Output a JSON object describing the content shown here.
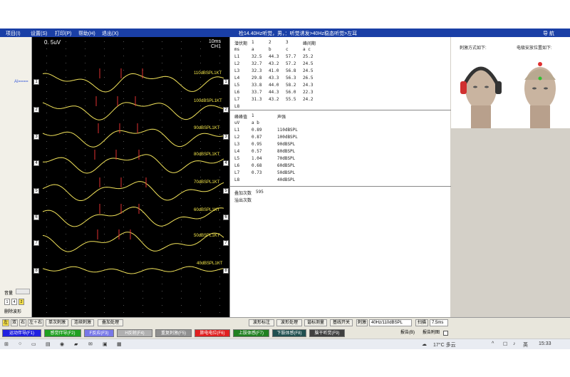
{
  "window": {
    "title": "检14.40Hz听觉，男，：听觉诱发>40Hz稳态听觉>左耳",
    "brand": "导 航"
  },
  "menu": [
    "项目(I)",
    "设置(S)",
    "打印(P)",
    "帮助(H)",
    "退出(X)"
  ],
  "left": {
    "ai_label": "AI",
    "volume_label": "音量",
    "mini_buttons": [
      "1",
      "4",
      "2"
    ],
    "clear_wave": "删除波形"
  },
  "scope": {
    "scale": "0. 5uV",
    "time": "10ms",
    "channel": "CH1",
    "channels": [
      "1",
      "2",
      "3",
      "4",
      "5",
      "6",
      "7",
      "8"
    ],
    "db_labels": [
      "110dBSPL1KT",
      "100dBSPL1KT",
      "90dBSPL1KT",
      "80dBSPL1KT",
      "70dBSPL1KT",
      "60dBSPL1KT",
      "50dBSPL1KT",
      "40dBSPL1KT"
    ],
    "wave_color": "#f2e35a",
    "marker_color": "#e03030"
  },
  "latency": {
    "title_cols": [
      "潜伏期",
      "1",
      "2",
      "3",
      "峰间期"
    ],
    "unit_row": [
      "ms",
      "a",
      "b",
      "c",
      "a c"
    ],
    "rows": [
      [
        "L1",
        "32.5",
        "44.3",
        "57.7",
        "25.2"
      ],
      [
        "L2",
        "32.7",
        "43.2",
        "57.2",
        "24.5"
      ],
      [
        "L3",
        "32.3",
        "41.0",
        "56.8",
        "24.5"
      ],
      [
        "L4",
        "29.8",
        "43.3",
        "56.3",
        "26.5"
      ],
      [
        "L5",
        "33.8",
        "44.0",
        "58.2",
        "24.3"
      ],
      [
        "L6",
        "33.7",
        "44.3",
        "56.0",
        "22.3"
      ],
      [
        "L7",
        "31.3",
        "43.2",
        "55.5",
        "24.2"
      ],
      [
        "L8",
        "",
        "",
        "",
        ""
      ]
    ]
  },
  "amplitude": {
    "title_cols": [
      "峰峰值",
      "1",
      "声强"
    ],
    "unit_row": [
      "uV",
      "a b"
    ],
    "rows": [
      [
        "L1",
        "0.89",
        "110dBSPL"
      ],
      [
        "L2",
        "0.87",
        "100dBSPL"
      ],
      [
        "L3",
        "0.95",
        "90dBSPL"
      ],
      [
        "L4",
        "0.57",
        "80dBSPL"
      ],
      [
        "L5",
        "1.04",
        "70dBSPL"
      ],
      [
        "L6",
        "0.68",
        "60dBSPL"
      ],
      [
        "L7",
        "0.73",
        "50dBSPL"
      ],
      [
        "L8",
        "",
        "40dBSPL"
      ]
    ]
  },
  "counts": {
    "stack_label": "叠加次数",
    "stack_value": "595",
    "overflow_label": "溢出次数"
  },
  "images": {
    "left_caption": "刺激方式如下:",
    "right_caption": "电极安放位置如下:"
  },
  "controls": {
    "left_buttons": [
      "左",
      "双",
      "右",
      "左＋右",
      "单次刺激",
      "连续刺激",
      "叠加处理"
    ],
    "right_buttons": [
      "波形标注",
      "波形处理",
      "谐标测量",
      "基线开关"
    ],
    "stim_label": "刺激",
    "stim_value": "40Hz/110dBSPL",
    "scan_label": "扫描",
    "scan_value": "7.5ms"
  },
  "fkeys": [
    {
      "label": "运动伴导(F1)",
      "color": "#2020e0"
    },
    {
      "label": "感觉伴导(F2)",
      "color": "#20a020"
    },
    {
      "label": "F反应(F3)",
      "color": "#7878e8"
    },
    {
      "label": "H反射(F4)",
      "color": "#b0b0b0"
    },
    {
      "label": "重复刺激(F5)",
      "color": "#909090"
    },
    {
      "label": "肺电电位(F6)",
      "color": "#e02020"
    },
    {
      "label": "上肢体感(F7)",
      "color": "#208020"
    },
    {
      "label": "下肢体感(F8)",
      "color": "#205050"
    },
    {
      "label": "脑干听觉(F9)",
      "color": "#404040"
    }
  ],
  "report": {
    "label": "报告(B)",
    "attach": "报告附图"
  },
  "taskbar": {
    "weather": "17°C 多云",
    "ime": "英",
    "time": "15:33"
  }
}
